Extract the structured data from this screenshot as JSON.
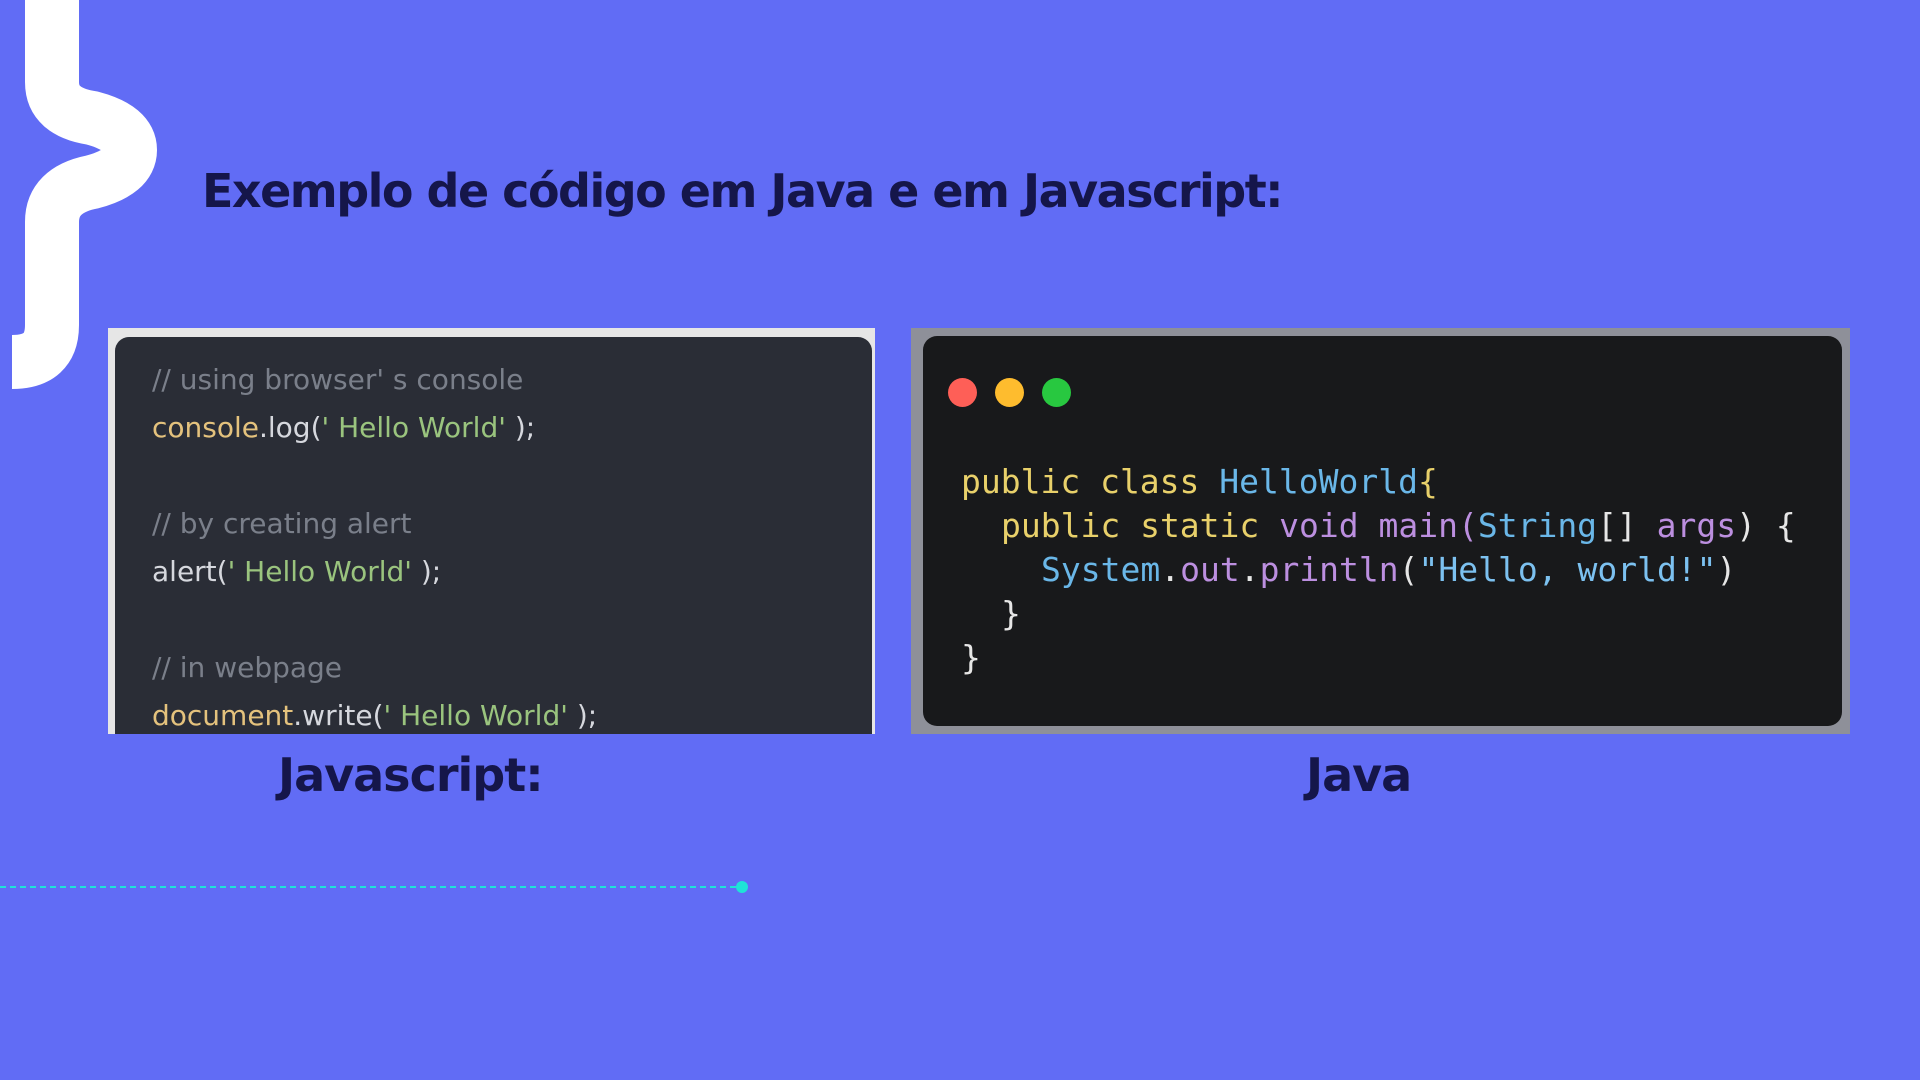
{
  "slide": {
    "title": "Exemplo de código em Java e em Javascript:",
    "colors": {
      "background": "#616cf5",
      "title_text": "#15164a",
      "accent_line": "#1ee3d7",
      "brace": "#ffffff"
    },
    "decorations": {
      "brace_icon": "curly-brace-right-icon",
      "connector": "dashed-line-with-dot-icon"
    }
  },
  "js_example": {
    "caption": "Javascript:",
    "lines": [
      {
        "text": "// using browser' s console",
        "tokens": [
          {
            "t": "// using browser' s console",
            "c": "comment"
          }
        ]
      },
      {
        "text": "console.log(' Hello World' );",
        "tokens": [
          {
            "t": "console",
            "c": "obj"
          },
          {
            "t": ".log(",
            "c": "fn"
          },
          {
            "t": "' Hello World'",
            "c": "str"
          },
          {
            "t": " );",
            "c": "punc"
          }
        ]
      },
      {
        "text": "// by creating alert",
        "tokens": [
          {
            "t": "// by creating alert",
            "c": "comment"
          }
        ]
      },
      {
        "text": "alert(' Hello World' );",
        "tokens": [
          {
            "t": "alert(",
            "c": "fn"
          },
          {
            "t": "' Hello World'",
            "c": "str"
          },
          {
            "t": " );",
            "c": "punc"
          }
        ]
      },
      {
        "text": "// in webpage",
        "tokens": [
          {
            "t": "// in webpage",
            "c": "comment"
          }
        ]
      },
      {
        "text": "document.write(' Hello World' );",
        "tokens": [
          {
            "t": "document",
            "c": "obj"
          },
          {
            "t": ".write(",
            "c": "fn"
          },
          {
            "t": "' Hello World'",
            "c": "str"
          },
          {
            "t": " );",
            "c": "punc"
          }
        ]
      }
    ]
  },
  "java_example": {
    "caption": "Java",
    "window_controls": [
      "close-dot-red",
      "minimize-dot-yellow",
      "maximize-dot-green"
    ],
    "lines": [
      {
        "text": "public class HelloWorld{",
        "tokens": [
          {
            "t": "public class ",
            "c": "kw"
          },
          {
            "t": "HelloWorld",
            "c": "cls"
          },
          {
            "t": "{",
            "c": "kw"
          }
        ]
      },
      {
        "text": "  public static void main(String[] args) {",
        "tokens": [
          {
            "t": "public static ",
            "c": "kw"
          },
          {
            "t": "void main(",
            "c": "mtd"
          },
          {
            "t": "String",
            "c": "cls"
          },
          {
            "t": "[] ",
            "c": "plain"
          },
          {
            "t": "args",
            "c": "mtd"
          },
          {
            "t": ") {",
            "c": "plain"
          }
        ]
      },
      {
        "text": "    System.out.println(\"Hello, world!\")",
        "tokens": [
          {
            "t": "System",
            "c": "cls"
          },
          {
            "t": ".",
            "c": "plain"
          },
          {
            "t": "out",
            "c": "mtd"
          },
          {
            "t": ".",
            "c": "plain"
          },
          {
            "t": "println",
            "c": "mtd"
          },
          {
            "t": "(",
            "c": "plain"
          },
          {
            "t": "\"Hello, world!\"",
            "c": "str"
          },
          {
            "t": ")",
            "c": "plain"
          }
        ]
      },
      {
        "text": "  }",
        "tokens": [
          {
            "t": "}",
            "c": "plain"
          }
        ]
      },
      {
        "text": "}",
        "tokens": [
          {
            "t": "}",
            "c": "plain"
          }
        ]
      }
    ]
  }
}
